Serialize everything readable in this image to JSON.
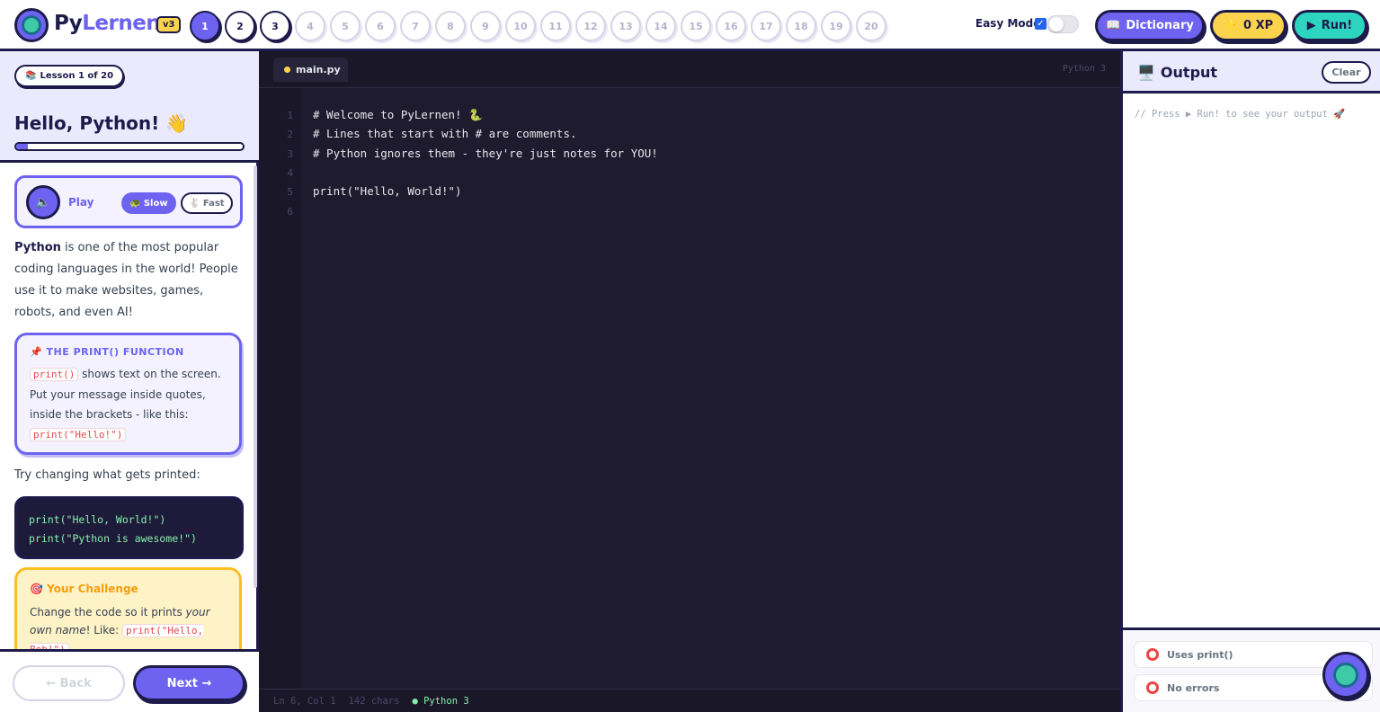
{
  "header": {
    "brand_py": "Py",
    "brand_rest": "Lernen",
    "version": "v3",
    "lessons": [
      "1",
      "2",
      "3",
      "4",
      "5",
      "6",
      "7",
      "8",
      "9",
      "10",
      "11",
      "12",
      "13",
      "14",
      "15",
      "16",
      "17",
      "18",
      "19",
      "20"
    ],
    "active_lesson": "1",
    "easy_mode_label": "Easy Mode",
    "easy_mode_checked": true,
    "dictionary_label": "Dictionary",
    "xp_label": "0 XP",
    "run_label": "Run!"
  },
  "lesson": {
    "chip": "Lesson 1 of 20",
    "title": "Hello, Python! 👋",
    "progress_fraction": 0.05,
    "player": {
      "play_label": "Play",
      "slow_label": "Slow",
      "fast_label": "Fast"
    },
    "intro_bold": "Python",
    "intro_rest": " is one of the most popular coding languages in the world! People use it to make websites, games, robots, and even AI!",
    "note": {
      "title": "THE PRINT() FUNCTION",
      "code1": "print()",
      "text1": " shows text on the screen. Put your message inside quotes, inside the brackets - like this: ",
      "code2": "print(\"Hello!\")"
    },
    "try_text": "Try changing what gets printed:",
    "example_code": [
      "print(\"Hello, World!\")",
      "print(\"Python is awesome!\")"
    ],
    "challenge": {
      "title": "Your Challenge",
      "text_a": "Change the code so it prints ",
      "text_em": "your own name",
      "text_b": "! Like: ",
      "code": "print(\"Hello, Bob!\")"
    },
    "back_label": "← Back",
    "next_label": "Next →"
  },
  "editor": {
    "tab": "main.py",
    "language": "Python 3",
    "lines": [
      "# Welcome to PyLernen! 🐍",
      "# Lines that start with # are comments.",
      "# Python ignores them - they're just notes for YOU!",
      "",
      "print(\"Hello, World!\")",
      ""
    ],
    "status_pos": "Ln 6, Col 1",
    "status_chars": "142 chars",
    "status_lang": "● Python 3"
  },
  "output": {
    "title": "Output",
    "clear_label": "Clear",
    "placeholder": "// Press ▶ Run! to see your output 🚀",
    "checks": [
      "Uses print()",
      "No errors"
    ]
  }
}
